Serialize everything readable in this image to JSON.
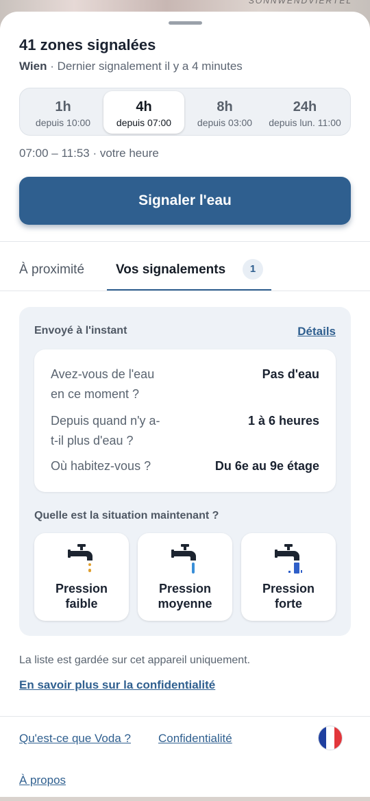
{
  "map": {
    "label": "SONNWENDVIERTEL"
  },
  "header": {
    "title": "41 zones signalées",
    "city": "Wien",
    "last_report": " · Dernier signalement il y a 4 minutes"
  },
  "time_filters": [
    {
      "label": "1h",
      "sub": "depuis 10:00",
      "active": false
    },
    {
      "label": "4h",
      "sub": "depuis 07:00",
      "active": true
    },
    {
      "label": "8h",
      "sub": "depuis 03:00",
      "active": false
    },
    {
      "label": "24h",
      "sub": "depuis lun. 11:00",
      "active": false
    }
  ],
  "time_range": "07:00 – 11:53 · votre heure",
  "cta": {
    "label": "Signaler l'eau"
  },
  "tabs": {
    "nearby": "À proximité",
    "mine": "Vos signalements",
    "mine_count": "1"
  },
  "report_card": {
    "sent": "Envoyé à l'instant",
    "details_link": "Détails",
    "answers": [
      {
        "question_line1": "Avez-vous de l'eau",
        "question_line2": "en ce moment ?",
        "answer": "Pas d'eau"
      },
      {
        "question_line1": "Depuis quand n'y a-",
        "question_line2": "t-il plus d'eau ?",
        "answer": "1 à 6 heures"
      },
      {
        "question_line1": "Où habitez-vous ?",
        "question_line2": "",
        "answer": "Du 6e au 9e étage"
      }
    ],
    "situation_question": "Quelle est la situation maintenant ?",
    "pressure_options": [
      {
        "line1": "Pression",
        "line2": "faible",
        "icon": "tap-drip-icon",
        "color": "#e0a030"
      },
      {
        "line1": "Pression",
        "line2": "moyenne",
        "icon": "tap-stream-icon",
        "color": "#3a8fd8"
      },
      {
        "line1": "Pression",
        "line2": "forte",
        "icon": "tap-strong-stream-icon",
        "color": "#2f5fc8"
      }
    ]
  },
  "privacy_note": "La liste est gardée sur cet appareil uniquement.",
  "privacy_link": "En savoir plus sur la confidentialité",
  "footer": {
    "what_is": "Qu'est-ce que Voda ?",
    "privacy": "Confidentialité",
    "about": "À propos",
    "language_icon": "france-flag-icon"
  },
  "colors": {
    "primary": "#2f5f8f",
    "card_bg": "#eef2f7",
    "flag_blue": "#1f3f9f",
    "flag_white": "#ffffff",
    "flag_red": "#e2363b"
  }
}
